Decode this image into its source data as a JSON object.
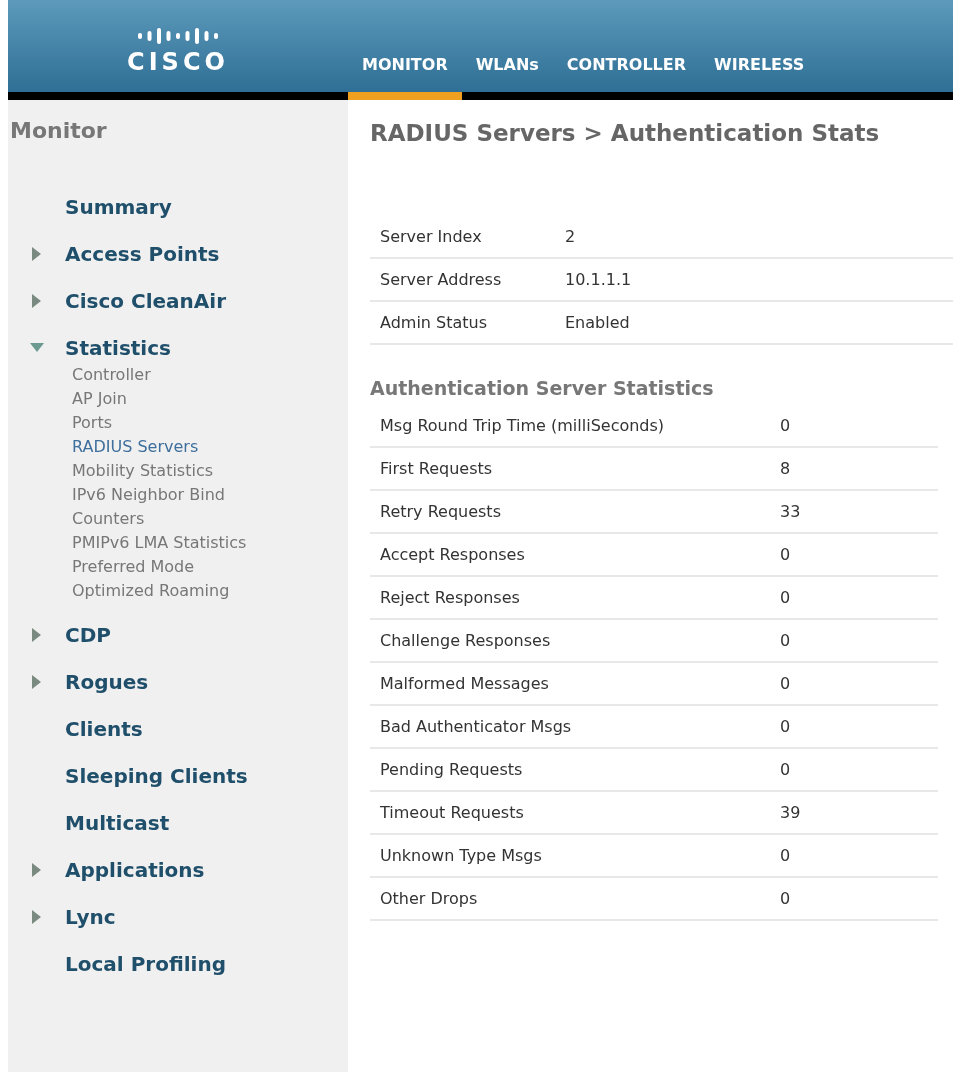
{
  "header": {
    "logo_text": "CISCO",
    "tabs": [
      {
        "label": "MONITOR",
        "selected": true
      },
      {
        "label": "WLANs",
        "selected": false
      },
      {
        "label": "CONTROLLER",
        "selected": false
      },
      {
        "label": "WIRELESS",
        "selected": false
      }
    ]
  },
  "sidebar": {
    "title": "Monitor",
    "items": [
      {
        "label": "Summary"
      },
      {
        "label": "Access Points",
        "expanded": false
      },
      {
        "label": "Cisco CleanAir",
        "expanded": false
      },
      {
        "label": "Statistics",
        "expanded": true,
        "children": [
          {
            "label": "Controller",
            "selected": false
          },
          {
            "label": "AP Join",
            "selected": false
          },
          {
            "label": "Ports",
            "selected": false
          },
          {
            "label": "RADIUS Servers",
            "selected": true
          },
          {
            "label": "Mobility Statistics",
            "selected": false
          },
          {
            "label": "IPv6 Neighbor Bind Counters",
            "selected": false
          },
          {
            "label": "PMIPv6 LMA Statistics",
            "selected": false
          },
          {
            "label": "Preferred Mode",
            "selected": false
          },
          {
            "label": "Optimized Roaming",
            "selected": false
          }
        ]
      },
      {
        "label": "CDP",
        "expanded": false
      },
      {
        "label": "Rogues",
        "expanded": false
      },
      {
        "label": "Clients"
      },
      {
        "label": "Sleeping Clients"
      },
      {
        "label": "Multicast"
      },
      {
        "label": "Applications",
        "expanded": false
      },
      {
        "label": "Lync",
        "expanded": false
      },
      {
        "label": "Local Profiling"
      }
    ]
  },
  "main": {
    "title": "RADIUS Servers > Authentication Stats",
    "server_info": [
      {
        "label": "Server Index",
        "value": "2"
      },
      {
        "label": "Server Address",
        "value": "10.1.1.1"
      },
      {
        "label": "Admin Status",
        "value": "Enabled"
      }
    ],
    "stats_title": "Authentication Server Statistics",
    "stats": [
      {
        "label": "Msg Round Trip Time (milliSeconds)",
        "value": "0"
      },
      {
        "label": "First Requests",
        "value": "8"
      },
      {
        "label": "Retry Requests",
        "value": "33"
      },
      {
        "label": "Accept Responses",
        "value": "0"
      },
      {
        "label": "Reject Responses",
        "value": "0"
      },
      {
        "label": "Challenge Responses",
        "value": "0"
      },
      {
        "label": "Malformed Messages",
        "value": "0"
      },
      {
        "label": "Bad Authenticator Msgs",
        "value": "0"
      },
      {
        "label": "Pending Requests",
        "value": "0"
      },
      {
        "label": "Timeout Requests",
        "value": "39"
      },
      {
        "label": "Unknown Type Msgs",
        "value": "0"
      },
      {
        "label": "Other Drops",
        "value": "0"
      }
    ]
  }
}
